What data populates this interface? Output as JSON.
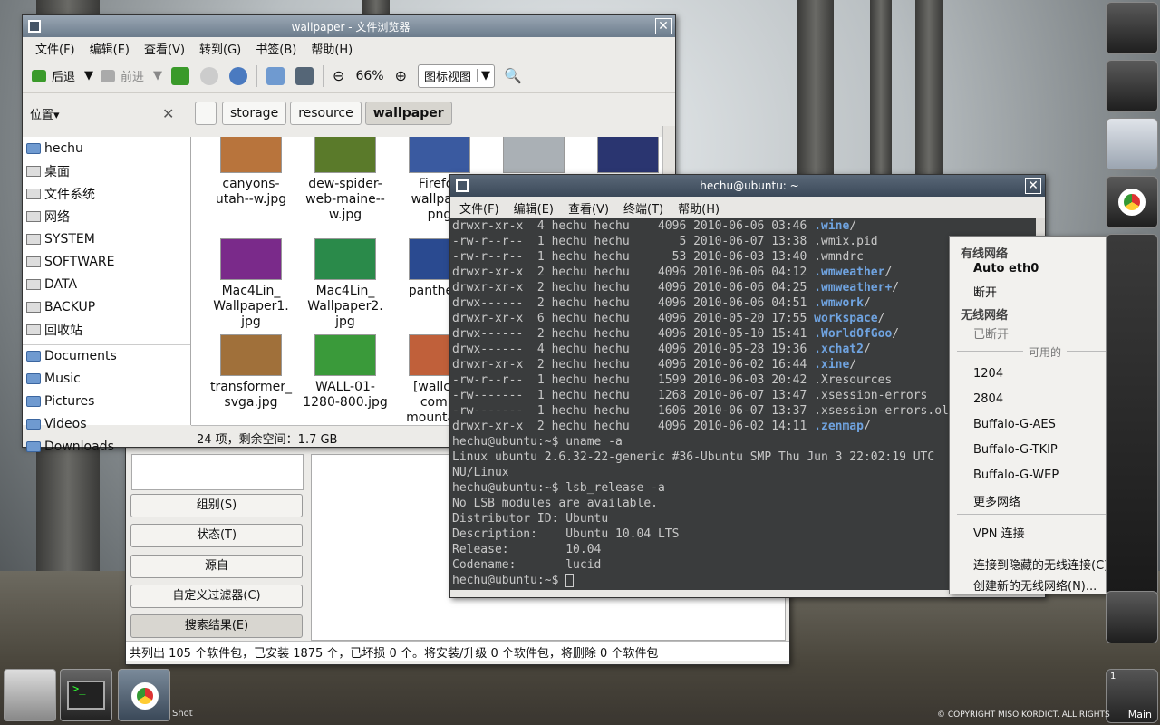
{
  "fm": {
    "title": "wallpaper - 文件浏览器",
    "menus": [
      "文件(F)",
      "编辑(E)",
      "查看(V)",
      "转到(G)",
      "书签(B)",
      "帮助(H)"
    ],
    "back": "后退",
    "forward": "前进",
    "zoom": "66%",
    "view_mode": "图标视图",
    "places": "位置",
    "crumbs": [
      "storage",
      "resource",
      "wallpaper"
    ],
    "side": [
      "hechu",
      "桌面",
      "文件系统",
      "网络",
      "SYSTEM",
      "SOFTWARE",
      "DATA",
      "BACKUP",
      "回收站",
      "Documents",
      "Music",
      "Pictures",
      "Videos",
      "Downloads"
    ],
    "files": [
      {
        "n": "canyons-\nutah--w.jpg",
        "c": "#b8743c"
      },
      {
        "n": "dew-spider-\nweb-maine--\nw.jpg",
        "c": "#5a7a2a"
      },
      {
        "n": "Firefox\nwallpape\npng",
        "c": "#3a5aa0"
      },
      {
        "n": "",
        "c": "#aab0b5"
      },
      {
        "n": "",
        "c": "#2a3570"
      },
      {
        "n": "Mac4Lin_\nWallpaper1.\njpg",
        "c": "#7a2a8a"
      },
      {
        "n": "Mac4Lin_\nWallpaper2.\njpg",
        "c": "#2a8a4a"
      },
      {
        "n": "panther1.",
        "c": "#2a4a90"
      },
      {
        "n": "transformer_\nsvga.jpg",
        "c": "#a0703a"
      },
      {
        "n": "WALL-01-\n1280-800.jpg",
        "c": "#3a9a3a"
      },
      {
        "n": "[wallcoo\ncom]_\nmountain_",
        "c": "#c0603a"
      }
    ],
    "status": "24 项，剩余空间：1.7 GB"
  },
  "term": {
    "title": "hechu@ubuntu: ~",
    "menus": [
      "文件(F)",
      "编辑(E)",
      "查看(V)",
      "终端(T)",
      "帮助(H)"
    ],
    "lines": [
      [
        "drwxr-xr-x  4 hechu hechu    4096 2010-06-06 03:46 ",
        ".wine",
        "/"
      ],
      [
        "-rw-r--r--  1 hechu hechu       5 2010-06-07 13:38 .wmix.pid",
        "",
        ""
      ],
      [
        "-rw-r--r--  1 hechu hechu      53 2010-06-03 13:40 .wmndrc",
        "",
        ""
      ],
      [
        "drwxr-xr-x  2 hechu hechu    4096 2010-06-06 04:12 ",
        ".wmweather",
        "/"
      ],
      [
        "drwxr-xr-x  2 hechu hechu    4096 2010-06-06 04:25 ",
        ".wmweather+",
        "/"
      ],
      [
        "drwx------  2 hechu hechu    4096 2010-06-06 04:51 ",
        ".wmwork",
        "/"
      ],
      [
        "drwxr-xr-x  6 hechu hechu    4096 2010-05-20 17:55 ",
        "workspace",
        "/"
      ],
      [
        "drwx------  2 hechu hechu    4096 2010-05-10 15:41 ",
        ".WorldOfGoo",
        "/"
      ],
      [
        "drwx------  4 hechu hechu    4096 2010-05-28 19:36 ",
        ".xchat2",
        "/"
      ],
      [
        "drwxr-xr-x  2 hechu hechu    4096 2010-06-02 16:44 ",
        ".xine",
        "/"
      ],
      [
        "-rw-r--r--  1 hechu hechu    1599 2010-06-03 20:42 .Xresources",
        "",
        ""
      ],
      [
        "-rw-------  1 hechu hechu    1268 2010-06-07 13:47 .xsession-errors",
        "",
        ""
      ],
      [
        "-rw-------  1 hechu hechu    1606 2010-06-07 13:37 .xsession-errors.ol",
        "",
        ""
      ],
      [
        "drwxr-xr-x  2 hechu hechu    4096 2010-06-02 14:11 ",
        ".zenmap",
        "/"
      ],
      [
        "hechu@ubuntu:~$ uname -a",
        "",
        ""
      ],
      [
        "Linux ubuntu 2.6.32-22-generic #36-Ubuntu SMP Thu Jun 3 22:02:19 UTC",
        "",
        ""
      ],
      [
        "NU/Linux",
        "",
        ""
      ],
      [
        "hechu@ubuntu:~$ lsb_release -a",
        "",
        ""
      ],
      [
        "No LSB modules are available.",
        "",
        ""
      ],
      [
        "Distributor ID: Ubuntu",
        "",
        ""
      ],
      [
        "Description:    Ubuntu 10.04 LTS",
        "",
        ""
      ],
      [
        "Release:        10.04",
        "",
        ""
      ],
      [
        "Codename:       lucid",
        "",
        ""
      ],
      [
        "hechu@ubuntu:~$ ",
        "",
        ""
      ]
    ]
  },
  "pkg": {
    "buttons": [
      "组别(S)",
      "状态(T)",
      "源自",
      "自定义过滤器(C)",
      "搜索结果(E)"
    ],
    "status": "共列出 105 个软件包，已安装 1875 个，已坏损 0 个。将安装/升级 0 个软件包，将删除 0 个软件包"
  },
  "net": {
    "wired_header": "有线网络",
    "wired_conn": "Auto eth0",
    "disconnect": "断开",
    "wireless_header": "无线网络",
    "wireless_state": "已断开",
    "available": "可用的",
    "networks": [
      "1204",
      "2804",
      "Buffalo-G-AES",
      "Buffalo-G-TKIP",
      "Buffalo-G-WEP"
    ],
    "more": "更多网络",
    "vpn": "VPN 连接",
    "hidden": "连接到隐藏的无线连接(C)...",
    "create": "创建新的无线网络(N)..."
  },
  "dock": {
    "main_label": "Main",
    "page_num": "1",
    "shot": "Shot"
  },
  "watermark": "© COPYRIGHT MISO KORDICT. ALL RIGHTS"
}
